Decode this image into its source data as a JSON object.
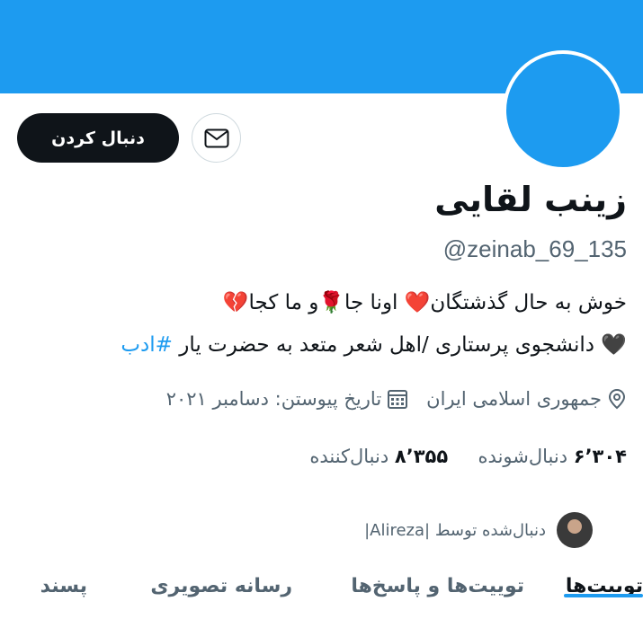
{
  "colors": {
    "accent": "#1d9bf0",
    "text": "#0f1419",
    "secondary": "#536471"
  },
  "profile": {
    "name": "زینب لقایی",
    "handle": "@zeinab_69_135",
    "follow_label": "دنبال کردن",
    "bio_line1": "خوش به حال گذشتگان❤️ اونا جا🌹و ما کجا💔",
    "bio_line2_text": "🖤 دانشجوی پرستاری /اهل شعر متعد به حضرت یار ",
    "bio_line2_hashtag": "#ادب",
    "location": "جمهوری اسلامی ایران",
    "joined": "تاریخ پیوستن: دسامبر ۲۰۲۱",
    "following_count": "۶٬۳۰۴",
    "following_label": "دنبال‌شونده",
    "followers_count": "۸٬۳۵۵",
    "followers_label": "دنبال‌کننده",
    "followed_by": "دنبال‌شده توسط |Alireza|"
  },
  "icons": {
    "message": "envelope-icon",
    "location": "location-pin-icon",
    "calendar": "calendar-icon"
  },
  "tabs": [
    {
      "label": "توییت‌ها",
      "active": true
    },
    {
      "label": "توییت‌ها و پاسخ‌ها",
      "active": false
    },
    {
      "label": "رسانه تصویری",
      "active": false
    },
    {
      "label": "پسند",
      "active": false
    }
  ]
}
